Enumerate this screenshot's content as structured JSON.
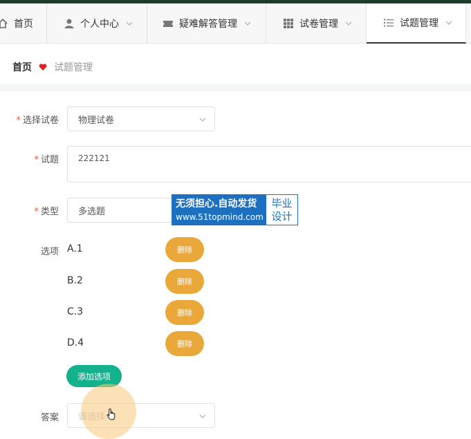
{
  "nav": {
    "items": [
      {
        "label": "首页",
        "icon": "home-icon",
        "has_dropdown": false
      },
      {
        "label": "个人中心",
        "icon": "user-icon",
        "has_dropdown": true
      },
      {
        "label": "疑难解答管理",
        "icon": "ticket-icon",
        "has_dropdown": true
      },
      {
        "label": "试卷管理",
        "icon": "grid-icon",
        "has_dropdown": true
      },
      {
        "label": "试题管理",
        "icon": "list-icon",
        "has_dropdown": true,
        "active": true
      }
    ]
  },
  "breadcrumb": {
    "home": "首页",
    "current": "试题管理",
    "separator_icon": "heart-icon",
    "separator_color": "#e02020"
  },
  "form": {
    "paper": {
      "label": "选择试卷",
      "required": true,
      "value": "物理试卷"
    },
    "question": {
      "label": "试题",
      "required": true,
      "value": "222121"
    },
    "type": {
      "label": "类型",
      "required": true,
      "value": "多选题"
    },
    "options": {
      "label": "选项",
      "items": [
        {
          "text": "A.1",
          "delete_label": "删除"
        },
        {
          "text": "B.2",
          "delete_label": "删除"
        },
        {
          "text": "C.3",
          "delete_label": "删除"
        },
        {
          "text": "D.4",
          "delete_label": "删除"
        }
      ],
      "add_label": "添加选项"
    },
    "answer": {
      "label": "答案",
      "placeholder": "请选择"
    }
  },
  "watermark": {
    "line1": "无须担心.自动发货",
    "line2": "www.51topmind.com",
    "badge_line1": "毕业",
    "badge_line2": "设计"
  },
  "colors": {
    "delete_button": "#eba83a",
    "add_button": "#13b18c",
    "required_star": "#e6553a",
    "watermark_blue": "#1d6fbf"
  }
}
